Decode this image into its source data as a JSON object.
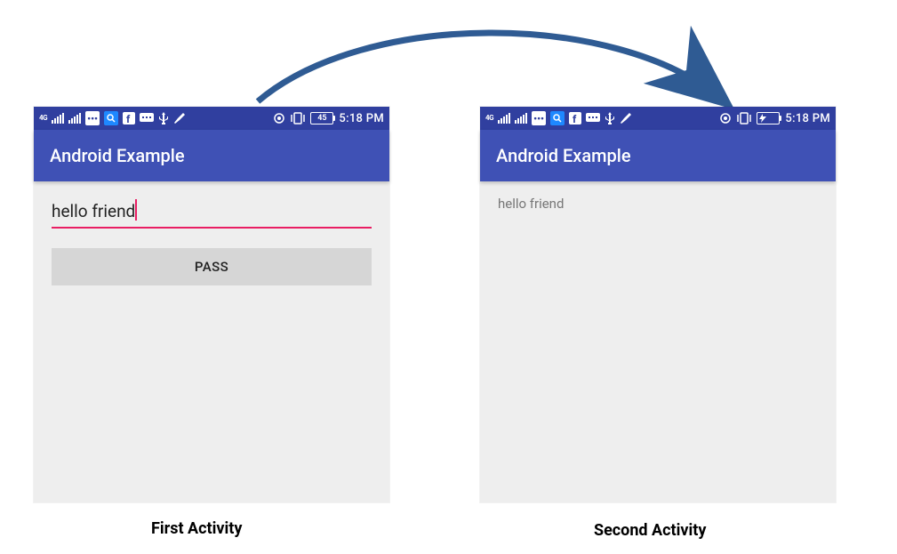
{
  "screens": {
    "first": {
      "statusbar": {
        "network_label": "4G",
        "battery_text": "45",
        "time": "5:18 PM"
      },
      "appbar": {
        "title": "Android Example"
      },
      "input": {
        "value": "hello friend"
      },
      "button": {
        "label": "PASS"
      }
    },
    "second": {
      "statusbar": {
        "network_label": "4G",
        "time": "5:18 PM"
      },
      "appbar": {
        "title": "Android Example"
      },
      "result_text": "hello friend"
    }
  },
  "captions": {
    "first": "First Activity",
    "second": "Second Activity"
  },
  "colors": {
    "primary": "#3f51b5",
    "primary_dark": "#303f9f",
    "accent": "#e91e63",
    "screen_bg": "#eeeeee",
    "button_bg": "#d6d6d6"
  }
}
